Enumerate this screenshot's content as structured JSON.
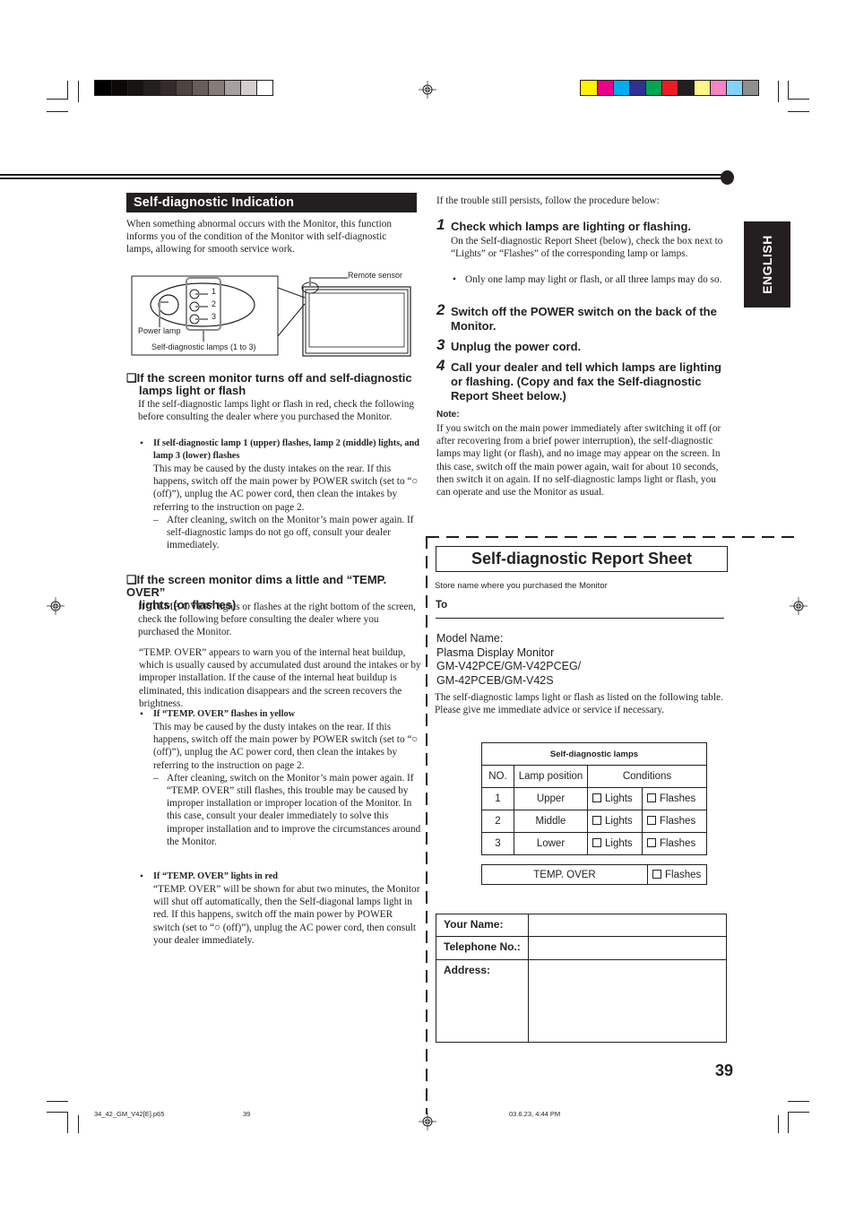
{
  "print_marks": {
    "grayscale_swatches": [
      "#000000",
      "#0b0908",
      "#171312",
      "#231f1e",
      "#332b2a",
      "#4e4542",
      "#685d5a",
      "#857b78",
      "#a8a09e",
      "#d5cdcb",
      "#ffffff"
    ],
    "color_swatches": [
      "#fff200",
      "#ec008c",
      "#00aeef",
      "#2e3192",
      "#00a651",
      "#ed1c24",
      "#231f20",
      "#fff685",
      "#f584c4",
      "#7fd4f7",
      "#8f8f8f"
    ]
  },
  "sidebar_tab": {
    "label": "ENGLISH"
  },
  "left": {
    "section_title": "Self-diagnostic Indication",
    "intro": "When something abnormal occurs with the Monitor, this function informs you of the condition of the Monitor with self-diagnostic lamps, allowing for smooth service work.",
    "diagram": {
      "lamp_numbers": [
        "1",
        "2",
        "3"
      ],
      "power_lamp_label": "Power lamp",
      "self_diag_label": "Self-diagnostic lamps (1 to 3)",
      "remote_sensor_label": "Remote sensor"
    },
    "sections": [
      {
        "heading_line1": "If the screen monitor turns off and self-diagnostic",
        "heading_line2": "lamps light or flash",
        "intro": "If the self-diagnostic lamps light or flash in red, check the following before consulting the dealer where you purchased the Monitor.",
        "bullets": [
          {
            "title": "If self-diagnostic lamp 1 (upper) flashes, lamp 2 (middle) lights, and lamp 3 (lower) flashes",
            "text": "This may be caused by the dusty intakes on the rear. If this happens, switch off the main power by POWER switch (set to “○ (off)”),  unplug the AC power cord, then clean the intakes by referring to the instruction on page 2.",
            "dash": "After cleaning, switch on the Monitor’s main power again. If self-diagnostic lamps do not go off, consult your dealer immediately."
          }
        ]
      },
      {
        "heading_line1": "If the screen monitor dims a little and “TEMP. OVER”",
        "heading_line2": "lights (or flashes)",
        "intro": "If “TEMP. OVER” lights or flashes at the right bottom of the screen, check the following before consulting the dealer where you purchased the Monitor.",
        "para2": "“TEMP. OVER” appears to warn you of the internal heat buildup, which is usually caused by accumulated dust around the intakes or by improper installation. If the cause of the internal heat buildup is eliminated, this indication disappears and the screen recovers the brightness.",
        "bullets": [
          {
            "title": "If “TEMP. OVER” flashes in yellow",
            "text": "This may be caused by the dusty intakes on the rear. If this happens, switch off the main power by POWER switch (set to “○ (off)”),  unplug the AC power cord, then clean the intakes by referring to the instruction on page 2.",
            "dash": "After cleaning, switch on the Monitor’s main power again. If “TEMP. OVER” still flashes, this trouble may be caused by improper installation or improper location of the Monitor. In this case, consult your dealer immediately to solve this improper installation and to improve the circumstances around the Monitor."
          },
          {
            "title": "If “TEMP. OVER” lights in red",
            "text": "“TEMP. OVER” will be shown for abut two minutes, the Monitor will shut off automatically, then the Self-diagonal lamps light in red. If this happens, switch off the main power by POWER switch (set to “○ (off)”), unplug the AC power cord, then consult your dealer immediately."
          }
        ]
      }
    ]
  },
  "right": {
    "intro": "If the trouble still persists, follow the procedure below:",
    "steps": [
      {
        "num": "1",
        "title": "Check which lamps are lighting or flashing.",
        "text": "On the Self-diagnostic Report Sheet (below), check the box next to “Lights” or “Flashes” of the corresponding lamp or lamps.",
        "bullet": "Only one lamp may light or flash, or all three lamps may do so."
      },
      {
        "num": "2",
        "title": "Switch off the POWER switch on the back of the Monitor."
      },
      {
        "num": "3",
        "title": "Unplug the power cord."
      },
      {
        "num": "4",
        "title": "Call your dealer and tell which lamps are lighting or flashing. (Copy and fax the Self-diagnostic Report Sheet below.)"
      }
    ],
    "note_label": "Note:",
    "note_text": "If you switch on the main power immediately after switching it off (or after recovering from a brief power interruption), the self-diagnostic lamps may light (or flash), and no image may appear on the screen. In this case, switch off the main power again, wait for about 10 seconds, then switch it on again. If no self-diagnostic lamps light or flash, you can operate and use the Monitor as usual."
  },
  "report_sheet": {
    "title": "Self-diagnostic Report Sheet",
    "store_label": "Store name where you purchased the Monitor",
    "to_label": "To",
    "to_value": "",
    "model_label": "Model Name:",
    "model_lines": [
      "Plasma Display Monitor",
      "GM-V42PCE/GM-V42PCEG/",
      "GM-42PCEB/GM-V42S"
    ],
    "message": "The self-diagnostic lamps light or flash as listed on the following table. Please give me immediate advice or service if necessary.",
    "lamp_table": {
      "caption": "Self-diagnostic lamps",
      "headers": [
        "NO.",
        "Lamp position",
        "Conditions"
      ],
      "rows": [
        {
          "no": "1",
          "position": "Upper",
          "lights": "Lights",
          "flashes": "Flashes",
          "lights_checked": false,
          "flashes_checked": false
        },
        {
          "no": "2",
          "position": "Middle",
          "lights": "Lights",
          "flashes": "Flashes",
          "lights_checked": false,
          "flashes_checked": false
        },
        {
          "no": "3",
          "position": "Lower",
          "lights": "Lights",
          "flashes": "Flashes",
          "lights_checked": false,
          "flashes_checked": false
        }
      ]
    },
    "temp_over": {
      "label": "TEMP. OVER",
      "flashes": "Flashes",
      "flashes_checked": false
    },
    "contact": [
      {
        "label": "Your Name:",
        "value": ""
      },
      {
        "label": "Telephone No.:",
        "value": ""
      },
      {
        "label": "Address:",
        "value": ""
      }
    ]
  },
  "page_number": "39",
  "footer": {
    "file": "34_42_GM_V42[E].p65",
    "page": "39",
    "timestamp": "03.6.23, 4:44 PM"
  }
}
